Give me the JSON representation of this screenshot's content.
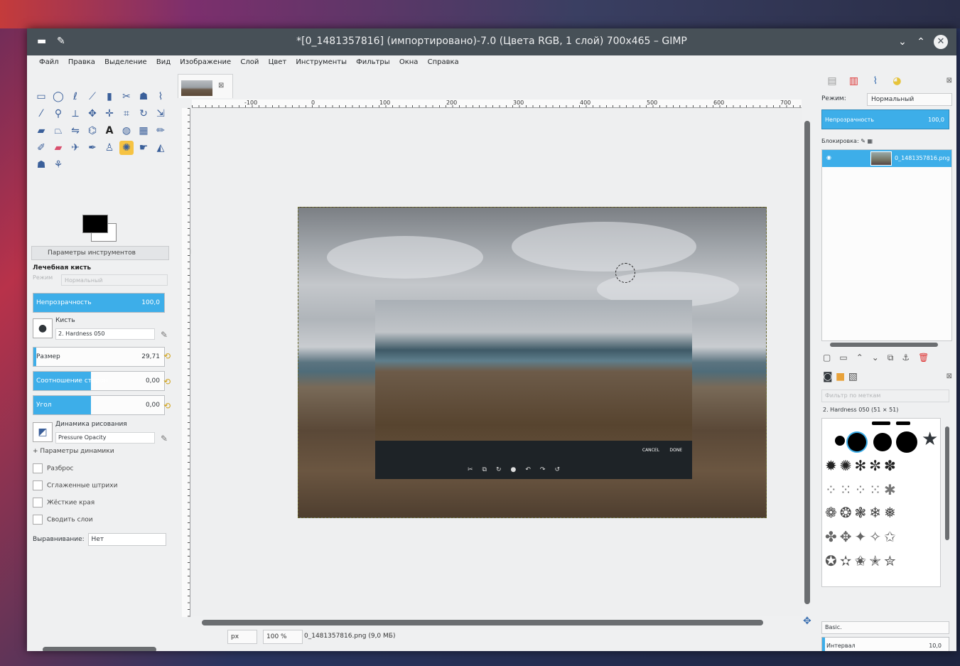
{
  "window": {
    "title": "*[0_1481357816] (импортировано)-7.0 (Цвета RGB, 1 слой) 700x465 – GIMP"
  },
  "menu": [
    "Файл",
    "Правка",
    "Выделение",
    "Вид",
    "Изображение",
    "Слой",
    "Цвет",
    "Инструменты",
    "Фильтры",
    "Окна",
    "Справка"
  ],
  "toolbox": {
    "tools": [
      "rect-select",
      "ellipse-select",
      "free-select",
      "fuzzy-select",
      "color-select",
      "scissors",
      "foreground-select",
      "paths",
      "color-picker",
      "zoom",
      "measure",
      "move",
      "align",
      "crop",
      "rotate",
      "scale",
      "shear",
      "perspective",
      "flip",
      "cage",
      "text",
      "bucket-fill",
      "blend",
      "pencil",
      "paintbrush",
      "eraser",
      "airbrush",
      "ink",
      "clone",
      "heal",
      "smudge",
      "dodge-burn",
      "perspective-clone",
      "blur",
      "mypaint"
    ],
    "options_tab": "Параметры инструментов",
    "tool_name": "Лечебная кисть",
    "mode_label": "Режим",
    "mode_value": "Нормальный",
    "opacity_label": "Непрозрачность",
    "opacity_value": "100,0",
    "brush_label": "Кисть",
    "brush_name": "2. Hardness 050",
    "size_label": "Размер",
    "size_value": "29,71",
    "ratio_label": "Соотношение сторон",
    "ratio_value": "0,00",
    "angle_label": "Угол",
    "angle_value": "0,00",
    "dynamics_label": "Динамика рисования",
    "dynamics_value": "Pressure Opacity",
    "dynamics_params": "+ Параметры динамики",
    "checks": [
      "Разброс",
      "Сглаженные штрихи",
      "Жёсткие края",
      "Сводить слои"
    ],
    "align_label": "Выравнивание:",
    "align_value": "Нет"
  },
  "canvas": {
    "ruler_labels": [
      "-100",
      "0",
      "100",
      "200",
      "300",
      "400",
      "500",
      "600",
      "700"
    ],
    "inner_cancel": "CANCEL",
    "inner_done": "DONE"
  },
  "status": {
    "unit": "px",
    "zoom": "100 %",
    "file": "0_1481357816.png (9,0 МБ)"
  },
  "dock": {
    "mode_label": "Режим:",
    "mode_value": "Нормальный",
    "opacity_label": "Непрозрачность",
    "opacity_value": "100,0",
    "lock_label": "Блокировка:",
    "layer_name": "0_1481357816.png",
    "brush_filter_placeholder": "Фильтр по меткам",
    "brush_title": "2. Hardness 050 (51 × 51)",
    "brush_set": "Basic.",
    "interval_label": "Интервал",
    "interval_value": "10,0"
  }
}
